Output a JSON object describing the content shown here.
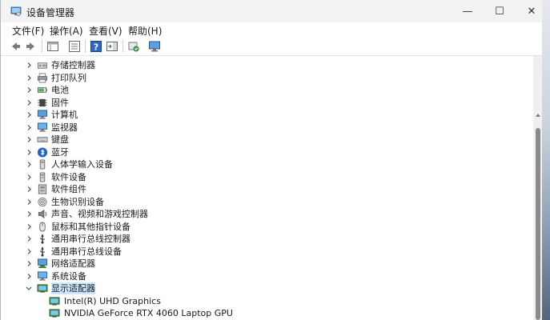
{
  "window": {
    "title": "设备管理器",
    "controls": {
      "minimize": "—",
      "maximize": "☐",
      "close": "✕"
    }
  },
  "menu": {
    "items": [
      {
        "label": "文件(F)"
      },
      {
        "label": "操作(A)"
      },
      {
        "label": "查看(V)"
      },
      {
        "label": "帮助(H)"
      }
    ]
  },
  "toolbar": {
    "buttons": [
      "back-icon",
      "forward-icon",
      "properties-pane-icon",
      "device-list-icon",
      "help-icon",
      "action-pane-icon",
      "scan-hardware-icon",
      "monitor-icon"
    ]
  },
  "tree": {
    "items": [
      {
        "label": "存储控制器",
        "icon": "storage-controller-icon",
        "expanded": false
      },
      {
        "label": "打印队列",
        "icon": "printer-icon",
        "expanded": false
      },
      {
        "label": "电池",
        "icon": "battery-icon",
        "expanded": false
      },
      {
        "label": "固件",
        "icon": "firmware-icon",
        "expanded": false
      },
      {
        "label": "计算机",
        "icon": "computer-icon",
        "expanded": false
      },
      {
        "label": "监视器",
        "icon": "monitor-icon",
        "expanded": false
      },
      {
        "label": "键盘",
        "icon": "keyboard-icon",
        "expanded": false
      },
      {
        "label": "蓝牙",
        "icon": "bluetooth-icon",
        "expanded": false
      },
      {
        "label": "人体学输入设备",
        "icon": "hid-icon",
        "expanded": false
      },
      {
        "label": "软件设备",
        "icon": "software-device-icon",
        "expanded": false
      },
      {
        "label": "软件组件",
        "icon": "software-component-icon",
        "expanded": false
      },
      {
        "label": "生物识别设备",
        "icon": "biometric-icon",
        "expanded": false
      },
      {
        "label": "声音、视频和游戏控制器",
        "icon": "sound-icon",
        "expanded": false
      },
      {
        "label": "鼠标和其他指针设备",
        "icon": "mouse-icon",
        "expanded": false
      },
      {
        "label": "通用串行总线控制器",
        "icon": "usb-icon",
        "expanded": false
      },
      {
        "label": "通用串行总线设备",
        "icon": "usb-icon",
        "expanded": false
      },
      {
        "label": "网络适配器",
        "icon": "network-adapter-icon",
        "expanded": false
      },
      {
        "label": "系统设备",
        "icon": "system-device-icon",
        "expanded": false
      },
      {
        "label": "显示适配器",
        "icon": "display-adapter-icon",
        "expanded": true
      }
    ],
    "children": [
      {
        "label": "Intel(R) UHD Graphics",
        "icon": "display-adapter-icon"
      },
      {
        "label": "NVIDIA GeForce RTX 4060 Laptop GPU",
        "icon": "display-adapter-icon"
      }
    ]
  },
  "colors": {
    "selection": "#cce8ff",
    "titlebar": "#f3f3f3",
    "accent": "#0078d4"
  }
}
